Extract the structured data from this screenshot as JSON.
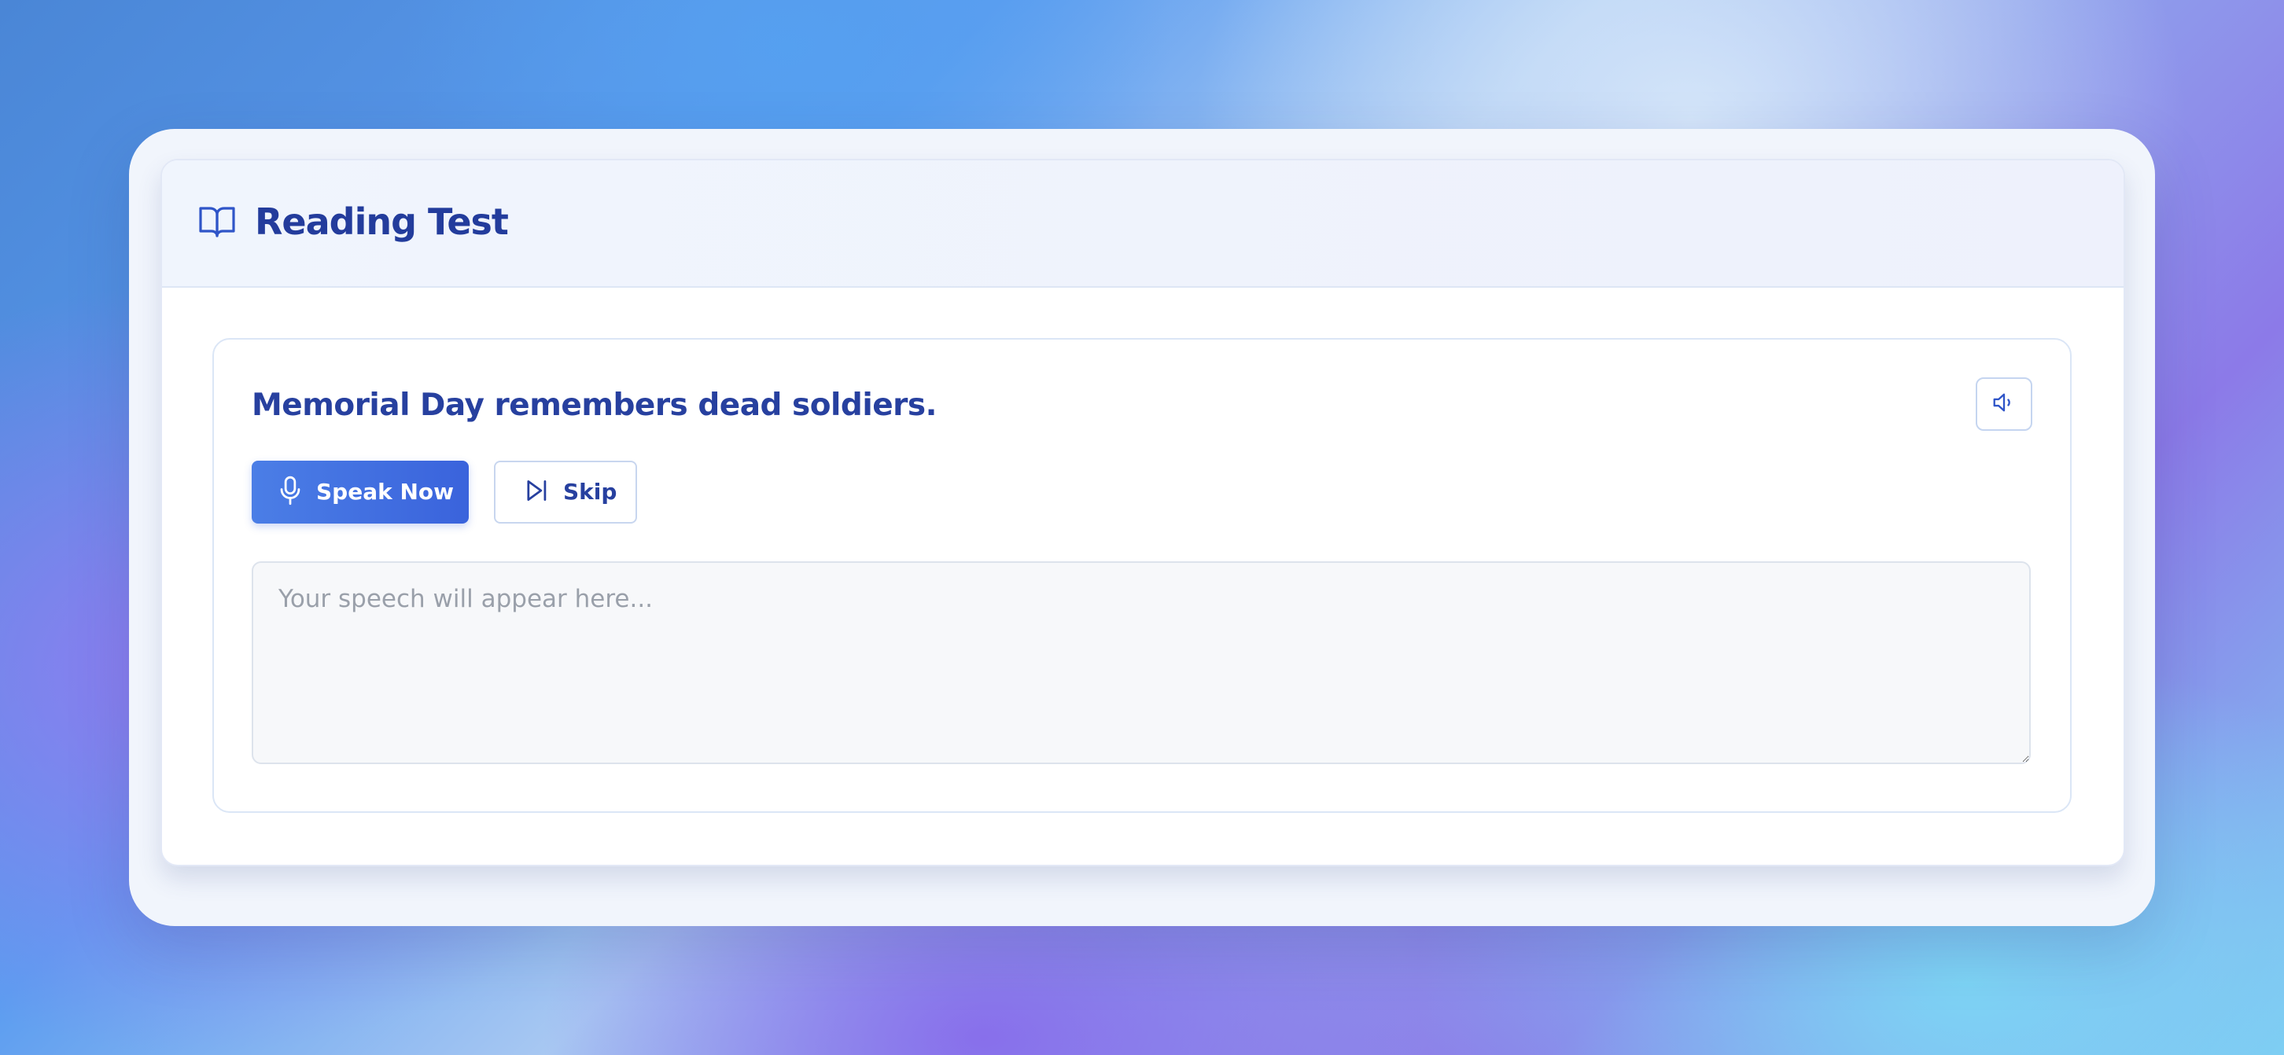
{
  "header": {
    "title": "Reading Test",
    "icon": "book-open-icon"
  },
  "question": {
    "sentence": "Memorial Day remembers dead soldiers.",
    "audio_icon": "speaker-icon"
  },
  "actions": {
    "speak_label": "Speak Now",
    "speak_icon": "microphone-icon",
    "skip_label": "Skip",
    "skip_icon": "skip-forward-icon"
  },
  "speech": {
    "value": "",
    "placeholder": "Your speech will appear here..."
  },
  "colors": {
    "accent": "#3f6fe2",
    "title": "#233c9c",
    "border": "#dbe6f6"
  }
}
